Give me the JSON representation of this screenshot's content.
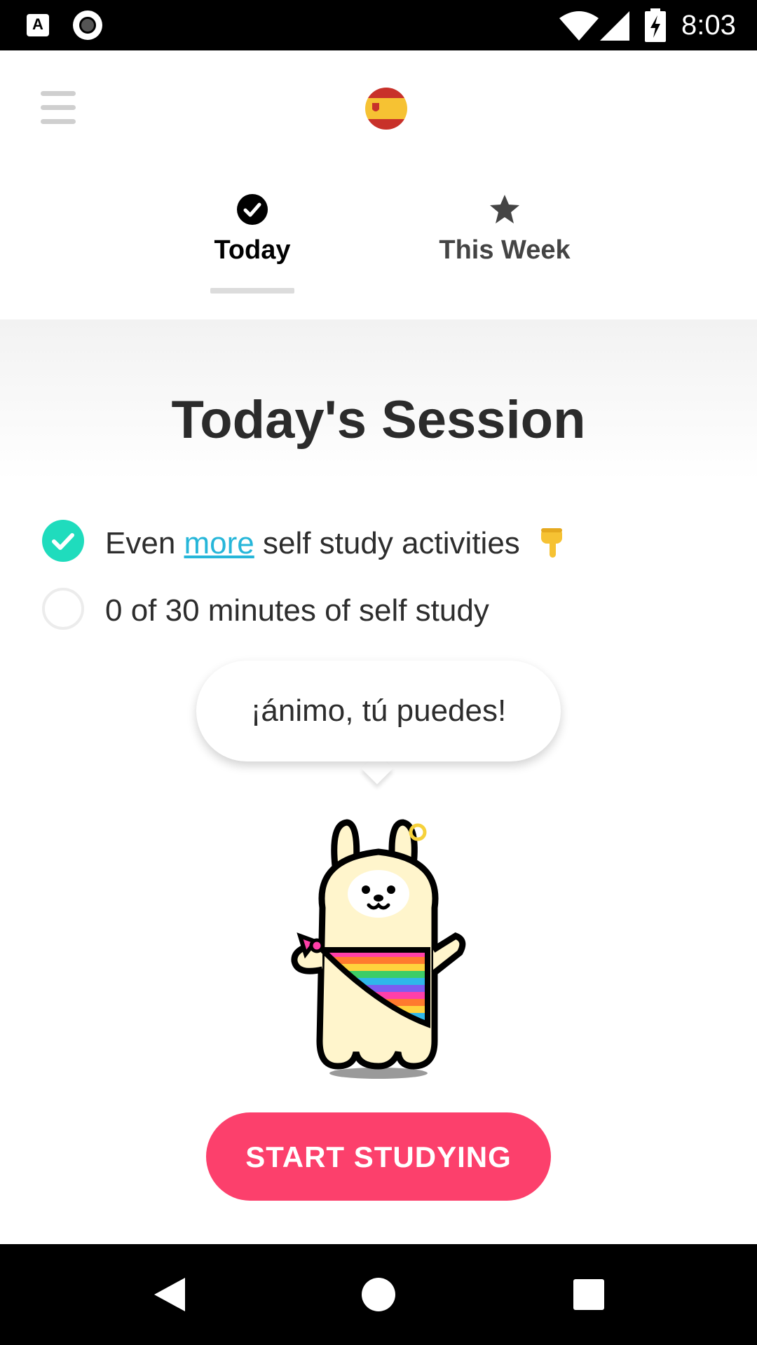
{
  "status_bar": {
    "time": "8:03",
    "notification_icons": [
      "app-a-icon",
      "record-icon"
    ],
    "system_icons": [
      "wifi-icon",
      "signal-icon",
      "battery-charging-icon"
    ]
  },
  "header": {
    "menu_icon": "hamburger-menu-icon",
    "language_flag": "spain-flag-icon"
  },
  "tabs": [
    {
      "label": "Today",
      "icon": "check-circle-icon",
      "selected": true
    },
    {
      "label": "This Week",
      "icon": "star-icon",
      "selected": false
    }
  ],
  "session": {
    "title": "Today's Session",
    "tasks": [
      {
        "prefix": "Even ",
        "link": "more",
        "suffix": " self study activities",
        "emoji": "hand-pointing-down-icon",
        "done": true
      },
      {
        "text": "0 of 30 minutes of self study",
        "done": false,
        "progress_minutes": 0,
        "goal_minutes": 30
      }
    ],
    "speech_bubble": "¡ánimo, tú puedes!",
    "mascot": "llama-mascot-icon",
    "cta_label": "START STUDYING"
  },
  "colors": {
    "accent_cta": "#fc406c",
    "check_done": "#1fdcbd",
    "link": "#26b6d9"
  },
  "nav_bar": {
    "buttons": [
      "back-icon",
      "home-icon",
      "recents-icon"
    ]
  }
}
